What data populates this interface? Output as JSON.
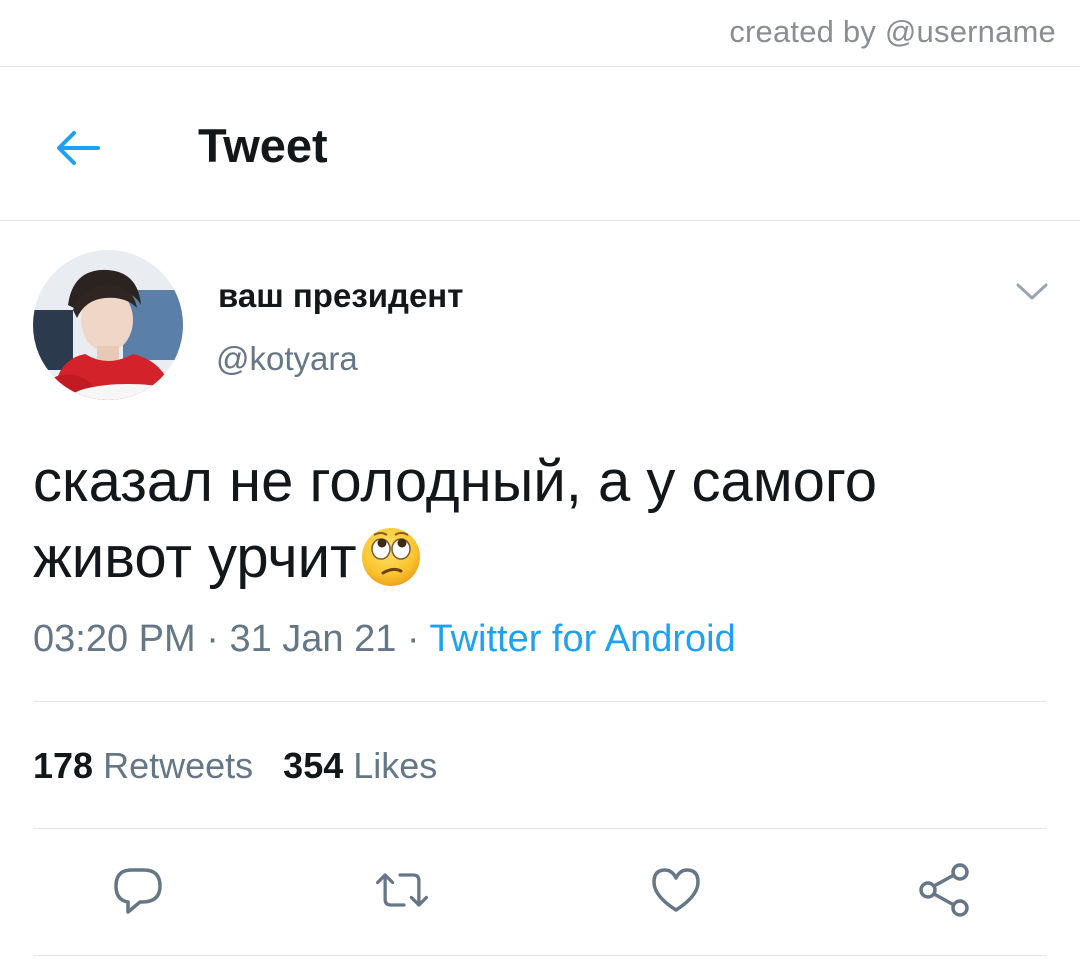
{
  "watermark": "created by @username",
  "header": {
    "title": "Tweet",
    "back_icon": "arrow-left-icon"
  },
  "author": {
    "display_name": "ваш президент",
    "handle": "@kotyara",
    "avatar": "user-avatar"
  },
  "tweet": {
    "line1": "сказал не голодный, а у самого",
    "line2": "живот урчит",
    "emoji": "face-with-rolling-eyes"
  },
  "meta": {
    "time": "03:20 PM",
    "sep1": " · ",
    "date": "31 Jan 21",
    "sep2": " · ",
    "source": "Twitter for Android"
  },
  "stats": {
    "retweets_count": "178",
    "retweets_label": "Retweets",
    "likes_count": "354",
    "likes_label": "Likes"
  },
  "actions": [
    "reply-icon",
    "retweet-icon",
    "like-icon",
    "share-icon"
  ],
  "colors": {
    "accent": "#1da1f2",
    "text": "#14171a",
    "muted": "#657786",
    "icon": "#657786"
  }
}
